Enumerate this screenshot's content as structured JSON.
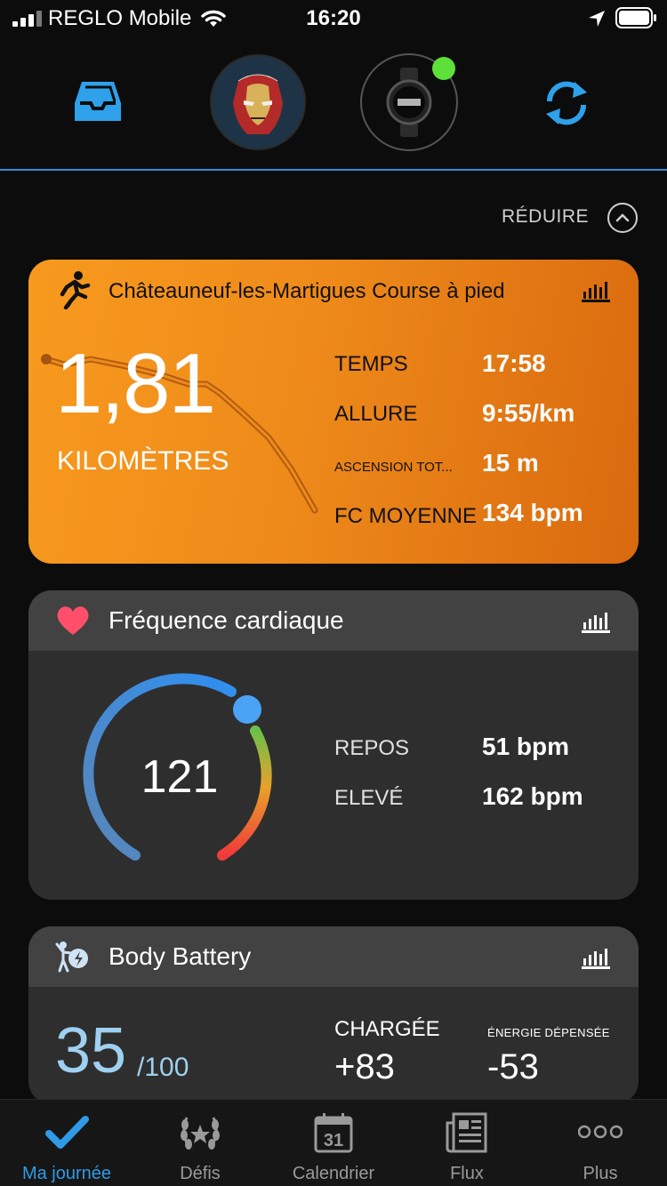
{
  "status_bar": {
    "carrier": "REGLO Mobile",
    "time": "16:20"
  },
  "header": {
    "avatar_alt": "WHATEVER IT TAKES",
    "device_status_color": "#5ee03a"
  },
  "reduce": {
    "label": "RÉDUIRE"
  },
  "activity": {
    "title": "Châteauneuf-les-Martigues Course à pied",
    "distance": "1,81",
    "unit": "KILOMÈTRES",
    "stats": [
      {
        "label": "TEMPS",
        "value": "17:58"
      },
      {
        "label": "ALLURE",
        "value": "9:55/km"
      },
      {
        "label": "ASCENSION TOT...",
        "value": "15 m"
      },
      {
        "label": "FC MOYENNE",
        "value": "134 bpm"
      }
    ],
    "accent": "#f89a1e"
  },
  "heart_rate": {
    "title": "Fréquence cardiaque",
    "current": "121",
    "rest_label": "REPOS",
    "rest_value": "51 bpm",
    "high_label": "ELEVÉ",
    "high_value": "162 bpm"
  },
  "body_battery": {
    "title": "Body Battery",
    "value": "35",
    "max": "/100",
    "charged_label": "CHARGÉE",
    "charged_value": "+83",
    "spent_label": "ÉNERGIE DÉPENSÉE",
    "spent_value": "-53"
  },
  "tabs": [
    {
      "label": "Ma journée",
      "icon": "check-icon",
      "active": true
    },
    {
      "label": "Défis",
      "icon": "laurel-icon",
      "active": false
    },
    {
      "label": "Calendrier",
      "icon": "calendar-icon",
      "active": false,
      "badge": "31"
    },
    {
      "label": "Flux",
      "icon": "newspaper-icon",
      "active": false
    },
    {
      "label": "Plus",
      "icon": "more-icon",
      "active": false
    }
  ],
  "colors": {
    "accent_blue": "#2f9be6",
    "activity_orange": "#f0891a",
    "heart_red": "#ff4f6a"
  }
}
